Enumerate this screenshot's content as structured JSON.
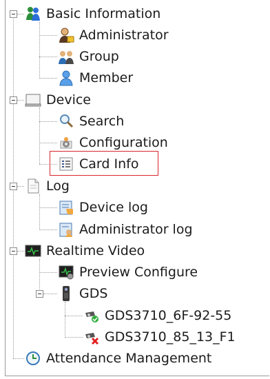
{
  "tree": {
    "basic_information": {
      "label": "Basic Information",
      "children": {
        "administrator": "Administrator",
        "group": "Group",
        "member": "Member"
      }
    },
    "device": {
      "label": "Device",
      "children": {
        "search": "Search",
        "configuration": "Configuration",
        "card_info": "Card Info"
      }
    },
    "log": {
      "label": "Log",
      "children": {
        "device_log": "Device log",
        "administrator_log": "Administrator log"
      }
    },
    "realtime_video": {
      "label": "Realtime Video",
      "children": {
        "preview_configure": "Preview Configure",
        "gds": {
          "label": "GDS",
          "children": {
            "gds_1": "GDS3710_6F-92-55",
            "gds_2": "GDS3710_85_13_F1"
          }
        }
      }
    },
    "attendance_management": {
      "label": "Attendance Management"
    }
  },
  "highlighted_item": "Card Info",
  "colors": {
    "highlight_border": "#d9252b",
    "tree_line": "#9a9a9a"
  }
}
